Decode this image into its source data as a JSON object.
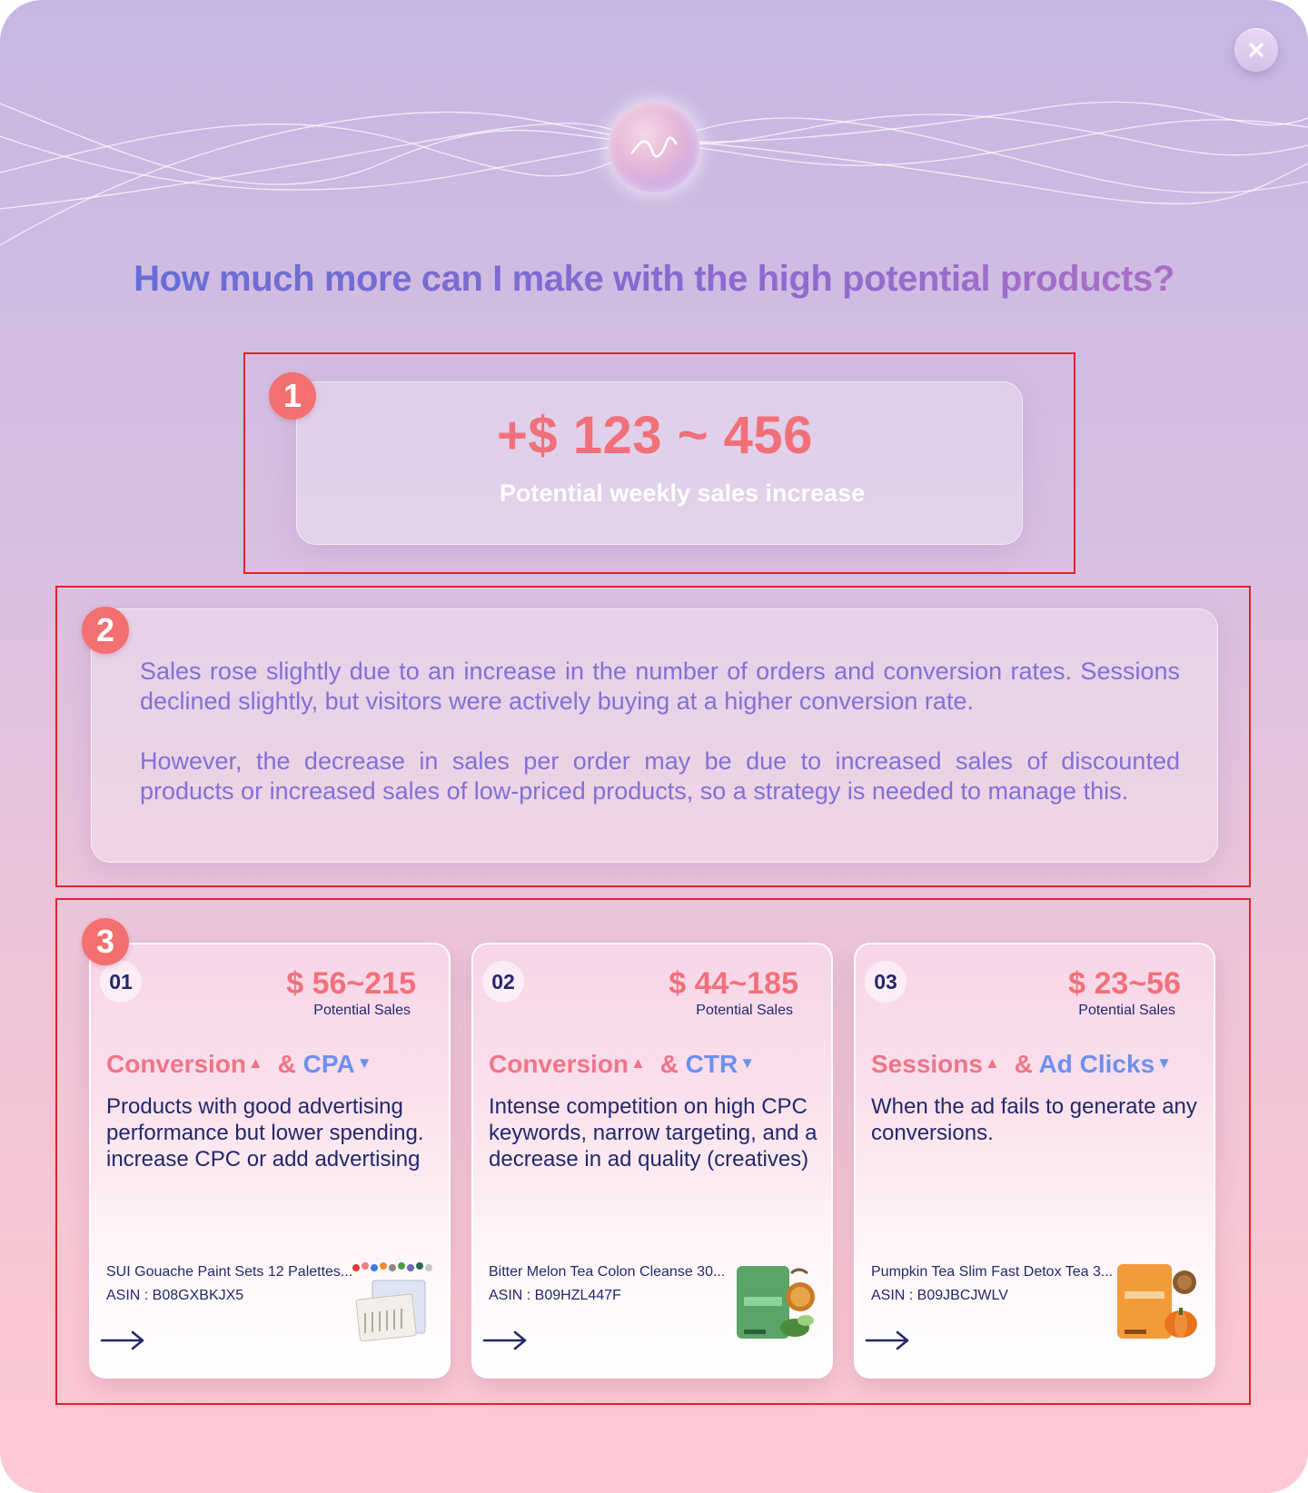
{
  "modal": {
    "headline": "How much more can I make with the high potential products?"
  },
  "summary": {
    "badge": "1",
    "value": "+$ 123 ~ 456",
    "label": "Potential weekly sales increase"
  },
  "insight": {
    "badge": "2",
    "paragraphs": [
      "Sales rose slightly due to an increase in the number of orders and conversion rates. Sessions declined slightly, but visitors were actively buying at a higher conversion rate.",
      "However, the decrease in sales per order may be due to increased sales of discounted products or increased sales of low-priced products, so a strategy is needed to manage this."
    ]
  },
  "products": {
    "badge": "3",
    "cards": [
      {
        "num": "01",
        "range": "$ 56~215",
        "range_label": "Potential Sales",
        "metric_up": "Conversion",
        "metric_join": "&",
        "metric_down": "CPA",
        "description": "Products with good advertising performance but lower spending. increase CPC or add advertising",
        "product_name": "SUI Gouache Paint Sets 12 Palettes...",
        "asin": "ASIN : B08GXBKJX5",
        "thumb_icon": "paint-set-icon"
      },
      {
        "num": "02",
        "range": "$ 44~185",
        "range_label": "Potential Sales",
        "metric_up": "Conversion",
        "metric_join": "&",
        "metric_down": "CTR",
        "description": "Intense competition on high CPC keywords, narrow targeting, and a decrease in ad quality (creatives)",
        "product_name": "Bitter Melon Tea Colon Cleanse 30...",
        "asin": "ASIN : B09HZL447F",
        "thumb_icon": "bitter-melon-tea-icon"
      },
      {
        "num": "03",
        "range": "$ 23~56",
        "range_label": "Potential Sales",
        "metric_up": "Sessions",
        "metric_join": "&",
        "metric_down": "Ad Clicks",
        "description": "When the ad fails to generate any conversions.",
        "product_name": "Pumpkin Tea Slim Fast Detox Tea 3...",
        "asin": "ASIN : B09JBCJWLV",
        "thumb_icon": "pumpkin-tea-icon"
      }
    ]
  },
  "colors": {
    "accent_pink": "#f2707a",
    "accent_blue": "#6e90ee",
    "text_navy": "#23286b",
    "annotation_red": "#e0242c"
  }
}
